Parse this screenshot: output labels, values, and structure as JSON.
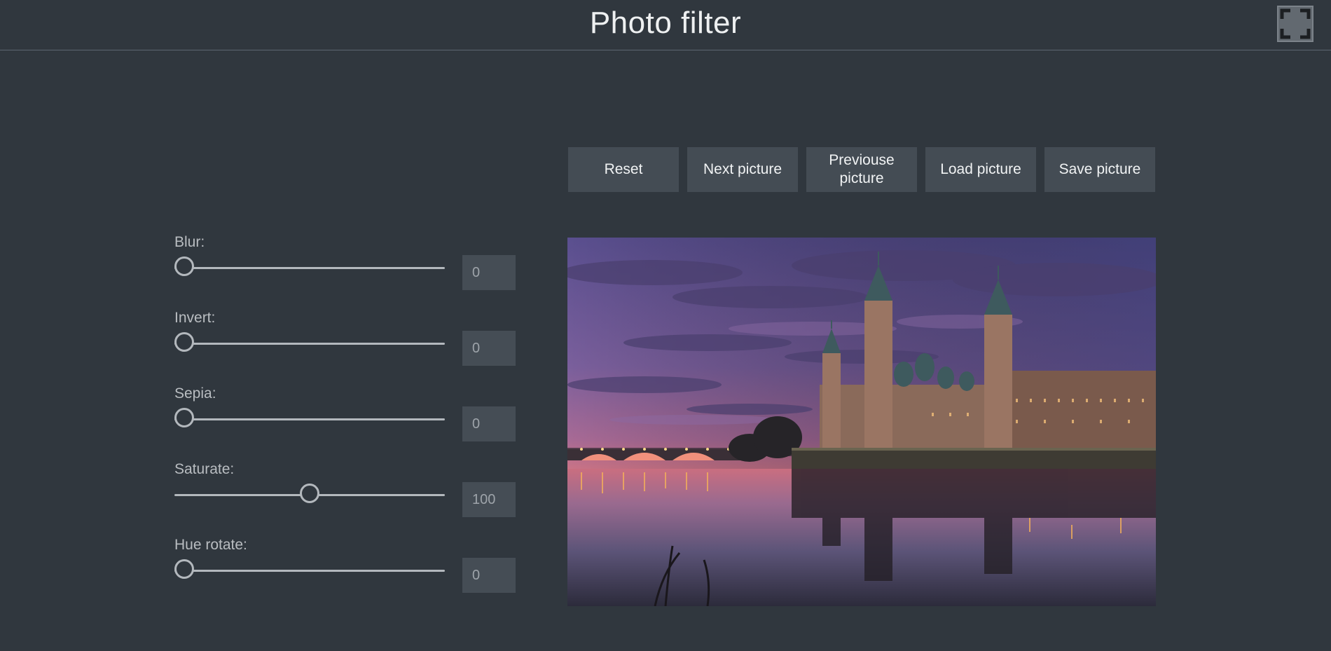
{
  "header": {
    "title": "Photo filter",
    "fullscreen_icon": "fullscreen-icon"
  },
  "toolbar": {
    "buttons": [
      {
        "id": "reset",
        "label": "Reset"
      },
      {
        "id": "next",
        "label": "Next picture"
      },
      {
        "id": "previous",
        "label": "Previouse picture"
      },
      {
        "id": "load",
        "label": "Load picture"
      },
      {
        "id": "save",
        "label": "Save picture"
      }
    ]
  },
  "filters": [
    {
      "id": "blur",
      "label": "Blur:",
      "value": "0",
      "level": 0
    },
    {
      "id": "invert",
      "label": "Invert:",
      "value": "0",
      "level": 0
    },
    {
      "id": "sepia",
      "label": "Sepia:",
      "value": "0",
      "level": 0
    },
    {
      "id": "saturate",
      "label": "Saturate:",
      "value": "100",
      "level": 0.5
    },
    {
      "id": "hue-rotate",
      "label": "Hue rotate:",
      "value": "0",
      "level": 0
    }
  ],
  "colors": {
    "background": "#30373e",
    "button_bg": "#444c54",
    "input_bg": "#454d55",
    "slider": "#b3b8bd",
    "title": "#eef0f1"
  }
}
